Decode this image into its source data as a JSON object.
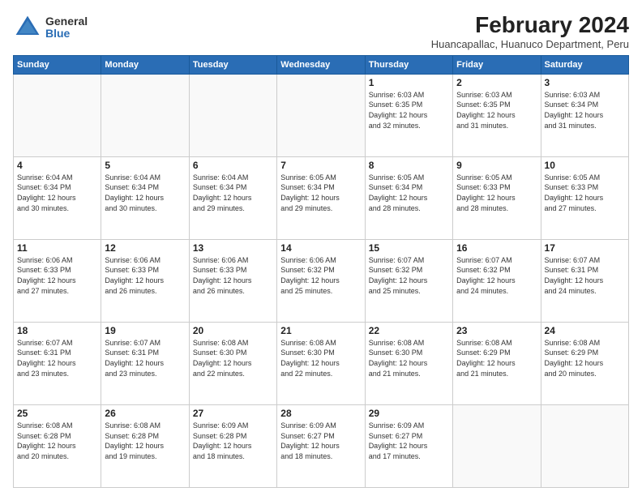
{
  "logo": {
    "general": "General",
    "blue": "Blue"
  },
  "title": "February 2024",
  "subtitle": "Huancapallac, Huanuco Department, Peru",
  "days_header": [
    "Sunday",
    "Monday",
    "Tuesday",
    "Wednesday",
    "Thursday",
    "Friday",
    "Saturday"
  ],
  "weeks": [
    [
      {
        "day": "",
        "detail": ""
      },
      {
        "day": "",
        "detail": ""
      },
      {
        "day": "",
        "detail": ""
      },
      {
        "day": "",
        "detail": ""
      },
      {
        "day": "1",
        "detail": "Sunrise: 6:03 AM\nSunset: 6:35 PM\nDaylight: 12 hours\nand 32 minutes."
      },
      {
        "day": "2",
        "detail": "Sunrise: 6:03 AM\nSunset: 6:35 PM\nDaylight: 12 hours\nand 31 minutes."
      },
      {
        "day": "3",
        "detail": "Sunrise: 6:03 AM\nSunset: 6:34 PM\nDaylight: 12 hours\nand 31 minutes."
      }
    ],
    [
      {
        "day": "4",
        "detail": "Sunrise: 6:04 AM\nSunset: 6:34 PM\nDaylight: 12 hours\nand 30 minutes."
      },
      {
        "day": "5",
        "detail": "Sunrise: 6:04 AM\nSunset: 6:34 PM\nDaylight: 12 hours\nand 30 minutes."
      },
      {
        "day": "6",
        "detail": "Sunrise: 6:04 AM\nSunset: 6:34 PM\nDaylight: 12 hours\nand 29 minutes."
      },
      {
        "day": "7",
        "detail": "Sunrise: 6:05 AM\nSunset: 6:34 PM\nDaylight: 12 hours\nand 29 minutes."
      },
      {
        "day": "8",
        "detail": "Sunrise: 6:05 AM\nSunset: 6:34 PM\nDaylight: 12 hours\nand 28 minutes."
      },
      {
        "day": "9",
        "detail": "Sunrise: 6:05 AM\nSunset: 6:33 PM\nDaylight: 12 hours\nand 28 minutes."
      },
      {
        "day": "10",
        "detail": "Sunrise: 6:05 AM\nSunset: 6:33 PM\nDaylight: 12 hours\nand 27 minutes."
      }
    ],
    [
      {
        "day": "11",
        "detail": "Sunrise: 6:06 AM\nSunset: 6:33 PM\nDaylight: 12 hours\nand 27 minutes."
      },
      {
        "day": "12",
        "detail": "Sunrise: 6:06 AM\nSunset: 6:33 PM\nDaylight: 12 hours\nand 26 minutes."
      },
      {
        "day": "13",
        "detail": "Sunrise: 6:06 AM\nSunset: 6:33 PM\nDaylight: 12 hours\nand 26 minutes."
      },
      {
        "day": "14",
        "detail": "Sunrise: 6:06 AM\nSunset: 6:32 PM\nDaylight: 12 hours\nand 25 minutes."
      },
      {
        "day": "15",
        "detail": "Sunrise: 6:07 AM\nSunset: 6:32 PM\nDaylight: 12 hours\nand 25 minutes."
      },
      {
        "day": "16",
        "detail": "Sunrise: 6:07 AM\nSunset: 6:32 PM\nDaylight: 12 hours\nand 24 minutes."
      },
      {
        "day": "17",
        "detail": "Sunrise: 6:07 AM\nSunset: 6:31 PM\nDaylight: 12 hours\nand 24 minutes."
      }
    ],
    [
      {
        "day": "18",
        "detail": "Sunrise: 6:07 AM\nSunset: 6:31 PM\nDaylight: 12 hours\nand 23 minutes."
      },
      {
        "day": "19",
        "detail": "Sunrise: 6:07 AM\nSunset: 6:31 PM\nDaylight: 12 hours\nand 23 minutes."
      },
      {
        "day": "20",
        "detail": "Sunrise: 6:08 AM\nSunset: 6:30 PM\nDaylight: 12 hours\nand 22 minutes."
      },
      {
        "day": "21",
        "detail": "Sunrise: 6:08 AM\nSunset: 6:30 PM\nDaylight: 12 hours\nand 22 minutes."
      },
      {
        "day": "22",
        "detail": "Sunrise: 6:08 AM\nSunset: 6:30 PM\nDaylight: 12 hours\nand 21 minutes."
      },
      {
        "day": "23",
        "detail": "Sunrise: 6:08 AM\nSunset: 6:29 PM\nDaylight: 12 hours\nand 21 minutes."
      },
      {
        "day": "24",
        "detail": "Sunrise: 6:08 AM\nSunset: 6:29 PM\nDaylight: 12 hours\nand 20 minutes."
      }
    ],
    [
      {
        "day": "25",
        "detail": "Sunrise: 6:08 AM\nSunset: 6:28 PM\nDaylight: 12 hours\nand 20 minutes."
      },
      {
        "day": "26",
        "detail": "Sunrise: 6:08 AM\nSunset: 6:28 PM\nDaylight: 12 hours\nand 19 minutes."
      },
      {
        "day": "27",
        "detail": "Sunrise: 6:09 AM\nSunset: 6:28 PM\nDaylight: 12 hours\nand 18 minutes."
      },
      {
        "day": "28",
        "detail": "Sunrise: 6:09 AM\nSunset: 6:27 PM\nDaylight: 12 hours\nand 18 minutes."
      },
      {
        "day": "29",
        "detail": "Sunrise: 6:09 AM\nSunset: 6:27 PM\nDaylight: 12 hours\nand 17 minutes."
      },
      {
        "day": "",
        "detail": ""
      },
      {
        "day": "",
        "detail": ""
      }
    ]
  ]
}
